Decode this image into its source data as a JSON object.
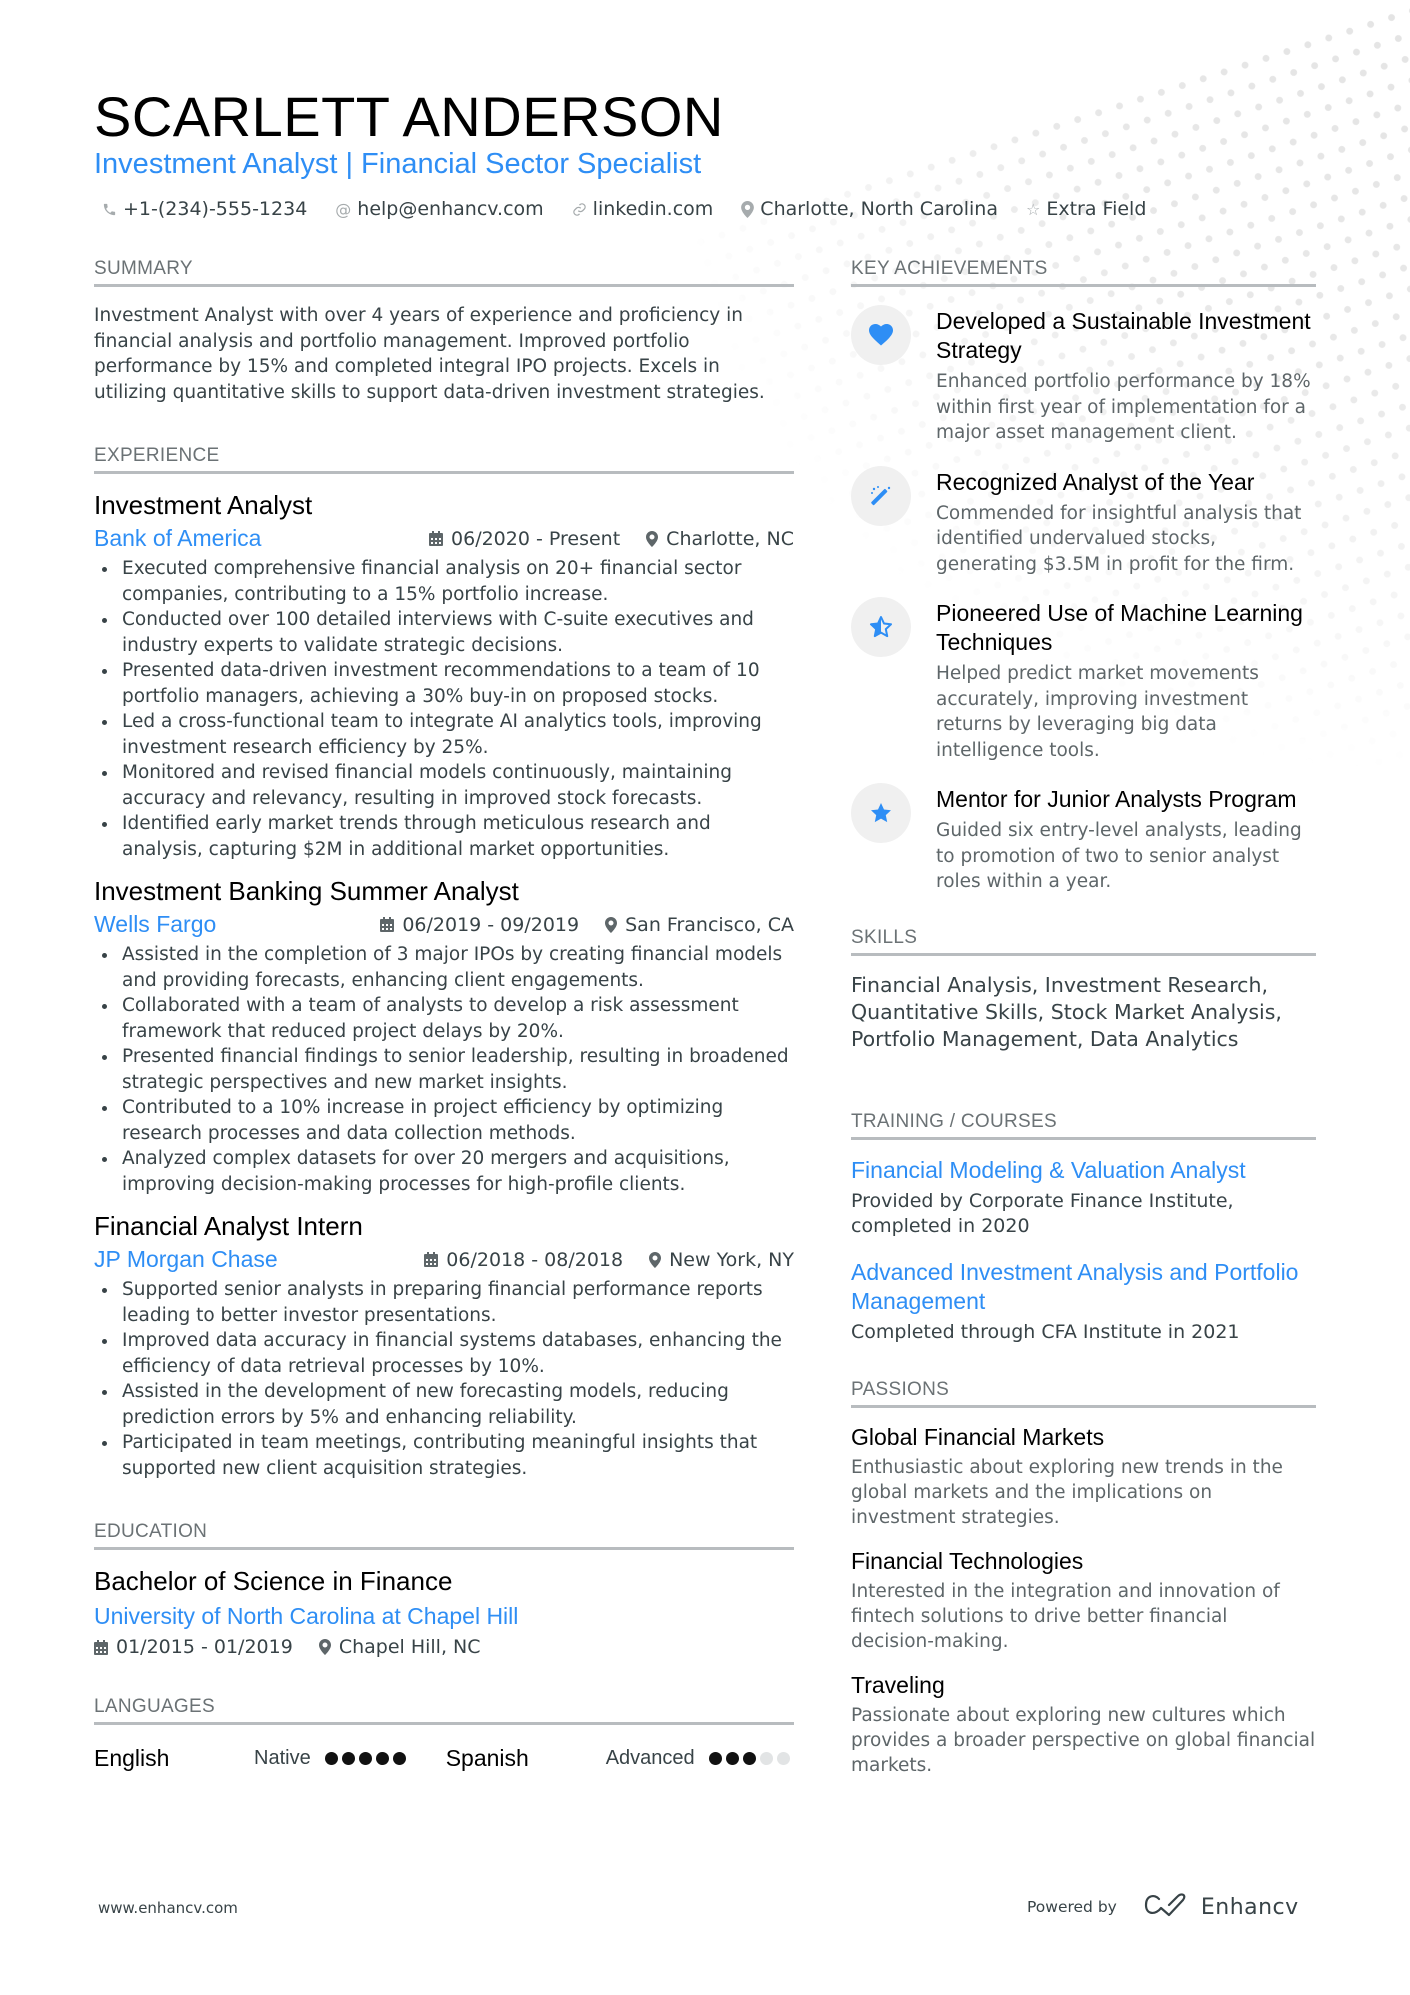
{
  "header": {
    "name": "SCARLETT ANDERSON",
    "title": "Investment Analyst | Financial Sector Specialist",
    "contacts": [
      {
        "icon": "phone-icon",
        "text": "+1-(234)-555-1234"
      },
      {
        "icon": "at-icon",
        "text": "help@enhancv.com"
      },
      {
        "icon": "link-icon",
        "text": "linkedin.com"
      },
      {
        "icon": "location-pin-icon",
        "text": "Charlotte, North Carolina"
      },
      {
        "icon": "star-outline-icon",
        "text": "Extra Field"
      }
    ]
  },
  "summary": {
    "heading": "SUMMARY",
    "text": "Investment Analyst with over 4 years of experience and proficiency in financial analysis and portfolio management. Improved portfolio performance by 15% and completed integral IPO projects. Excels in utilizing quantitative skills to support data-driven investment strategies."
  },
  "experience": {
    "heading": "EXPERIENCE",
    "jobs": [
      {
        "title": "Investment Analyst",
        "company": "Bank of America",
        "dates": "06/2020 - Present",
        "location": "Charlotte, NC",
        "bullets": [
          "Executed comprehensive financial analysis on 20+ financial sector companies, contributing to a 15% portfolio increase.",
          "Conducted over 100 detailed interviews with C-suite executives and industry experts to validate strategic decisions.",
          "Presented data-driven investment recommendations to a team of 10 portfolio managers, achieving a 30% buy-in on proposed stocks.",
          "Led a cross-functional team to integrate AI analytics tools, improving investment research efficiency by 25%.",
          "Monitored and revised financial models continuously, maintaining accuracy and relevancy, resulting in improved stock forecasts.",
          "Identified early market trends through meticulous research and analysis, capturing $2M in additional market opportunities."
        ]
      },
      {
        "title": "Investment Banking Summer Analyst",
        "company": "Wells Fargo",
        "dates": "06/2019 - 09/2019",
        "location": "San Francisco, CA",
        "bullets": [
          "Assisted in the completion of 3 major IPOs by creating financial models and providing forecasts, enhancing client engagements.",
          "Collaborated with a team of analysts to develop a risk assessment framework that reduced project delays by 20%.",
          "Presented financial findings to senior leadership, resulting in broadened strategic perspectives and new market insights.",
          "Contributed to a 10% increase in project efficiency by optimizing research processes and data collection methods.",
          "Analyzed complex datasets for over 20 mergers and acquisitions, improving decision-making processes for high-profile clients."
        ]
      },
      {
        "title": "Financial Analyst Intern",
        "company": "JP Morgan Chase",
        "dates": "06/2018 - 08/2018",
        "location": "New York, NY",
        "bullets": [
          "Supported senior analysts in preparing financial performance reports leading to better investor presentations.",
          "Improved data accuracy in financial systems databases, enhancing the efficiency of data retrieval processes by 10%.",
          "Assisted in the development of new forecasting models, reducing prediction errors by 5% and enhancing reliability.",
          "Participated in team meetings, contributing meaningful insights that supported new client acquisition strategies."
        ]
      }
    ]
  },
  "education": {
    "heading": "EDUCATION",
    "degree": "Bachelor of Science in Finance",
    "school": "University of North Carolina at Chapel Hill",
    "dates": "01/2015 - 01/2019",
    "location": "Chapel Hill, NC"
  },
  "languages": {
    "heading": "LANGUAGES",
    "items": [
      {
        "name": "English",
        "level": "Native",
        "rating": 5,
        "max": 5
      },
      {
        "name": "Spanish",
        "level": "Advanced",
        "rating": 3,
        "max": 5
      }
    ]
  },
  "achievements": {
    "heading": "KEY ACHIEVEMENTS",
    "items": [
      {
        "icon": "heart-icon",
        "title": "Developed a Sustainable Investment Strategy",
        "desc": "Enhanced portfolio performance by 18% within first year of implementation for a major asset management client."
      },
      {
        "icon": "magic-wand-icon",
        "title": "Recognized Analyst of the Year",
        "desc": "Commended for insightful analysis that identified undervalued stocks, generating $3.5M in profit for the firm."
      },
      {
        "icon": "half-star-icon",
        "title": "Pioneered Use of Machine Learning Techniques",
        "desc": "Helped predict market movements accurately, improving investment returns by leveraging big data intelligence tools."
      },
      {
        "icon": "star-icon",
        "title": "Mentor for Junior Analysts Program",
        "desc": "Guided six entry-level analysts, leading to promotion of two to senior analyst roles within a year."
      }
    ]
  },
  "skills": {
    "heading": "SKILLS",
    "text": "Financial Analysis, Investment Research, Quantitative Skills, Stock Market Analysis, Portfolio Management, Data Analytics"
  },
  "training": {
    "heading": "TRAINING / COURSES",
    "items": [
      {
        "title": "Financial Modeling & Valuation Analyst",
        "desc": "Provided by Corporate Finance Institute, completed in 2020"
      },
      {
        "title": "Advanced Investment Analysis and Portfolio Management",
        "desc": "Completed through CFA Institute in 2021"
      }
    ]
  },
  "passions": {
    "heading": "PASSIONS",
    "items": [
      {
        "title": "Global Financial Markets",
        "desc": "Enthusiastic about exploring new trends in the global markets and the implications on investment strategies."
      },
      {
        "title": "Financial Technologies",
        "desc": "Interested in the integration and innovation of fintech solutions to drive better financial decision-making."
      },
      {
        "title": "Traveling",
        "desc": "Passionate about exploring new cultures which provides a broader perspective on global financial markets."
      }
    ]
  },
  "footer": {
    "website": "www.enhancv.com",
    "powered_by": "Powered by",
    "brand": "Enhancv"
  },
  "colors": {
    "accent": "#2e8ef5",
    "text": "#384347",
    "heading_rule": "#b8bcbf"
  }
}
